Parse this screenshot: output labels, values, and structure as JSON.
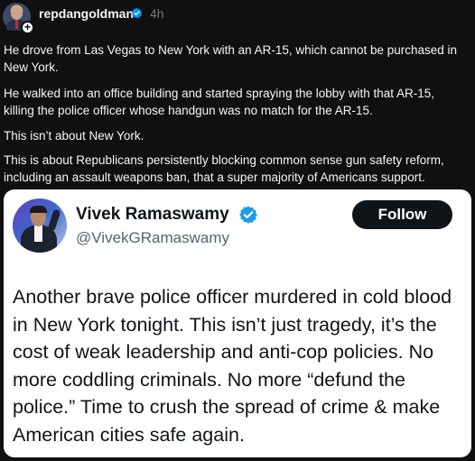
{
  "post": {
    "username": "repdangoldman",
    "time": "4h",
    "paragraphs": [
      "He drove from Las Vegas to New York with an AR-15, which cannot be purchased in New York.",
      "He walked into an office building and started spraying the lobby with that AR-15, killing the police officer whose handgun was no match for the AR-15.",
      "This isn’t about New York.",
      "This is about Republicans persistently blocking common sense gun safety reform, including an assault weapons ban, that a super majority of Americans support."
    ],
    "follow_badge": "+"
  },
  "embedded_tweet": {
    "name": "Vivek Ramaswamy",
    "handle": "@VivekGRamaswamy",
    "follow_label": "Follow",
    "body": "Another brave police officer murdered in cold blood in New York tonight. This isn’t just tragedy, it’s the cost of weak leadership and anti-cop policies. No more coddling criminals. No more “defund the police.” Time to crush the spread of crime & make American cities safe again."
  },
  "icons": {
    "verified_badge": "verified-check-icon",
    "plus_badge": "plus-icon"
  },
  "colors": {
    "background": "#101010",
    "card_background": "#ffffff",
    "verified_blue": "#1d9bf0",
    "threads_verified": "#0095f6",
    "follow_button": "#0f1419",
    "muted_text": "#777777",
    "handle_text": "#536471"
  }
}
